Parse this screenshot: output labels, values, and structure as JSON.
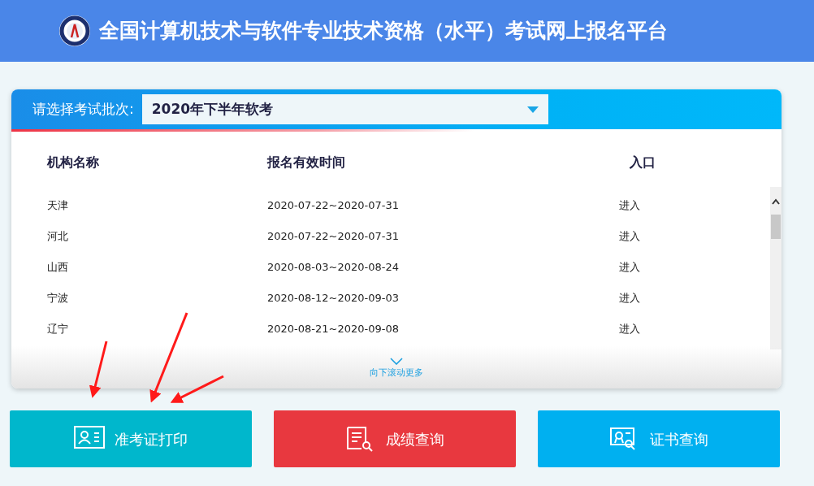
{
  "header": {
    "title": "全国计算机技术与软件专业技术资格（水平）考试网上报名平台"
  },
  "batch_select": {
    "label": "请选择考试批次:",
    "value": "2020年下半年软考"
  },
  "table": {
    "columns": [
      "机构名称",
      "报名有效时间",
      "入口"
    ],
    "rows": [
      {
        "name": "天津",
        "period": "2020-07-22~2020-07-31",
        "entry": "进入"
      },
      {
        "name": "河北",
        "period": "2020-07-22~2020-07-31",
        "entry": "进入"
      },
      {
        "name": "山西",
        "period": "2020-08-03~2020-08-24",
        "entry": "进入"
      },
      {
        "name": "宁波",
        "period": "2020-08-12~2020-09-03",
        "entry": "进入"
      },
      {
        "name": "辽宁",
        "period": "2020-08-21~2020-09-08",
        "entry": "进入"
      }
    ],
    "scroll_more": "向下滚动更多"
  },
  "actions": [
    {
      "kind": "ticket",
      "label": "准考证打印",
      "color": "#00b7cc"
    },
    {
      "kind": "score",
      "label": "成绩查询",
      "color": "#e8383f"
    },
    {
      "kind": "certificate",
      "label": "证书查询",
      "color": "#00b0f0"
    }
  ]
}
